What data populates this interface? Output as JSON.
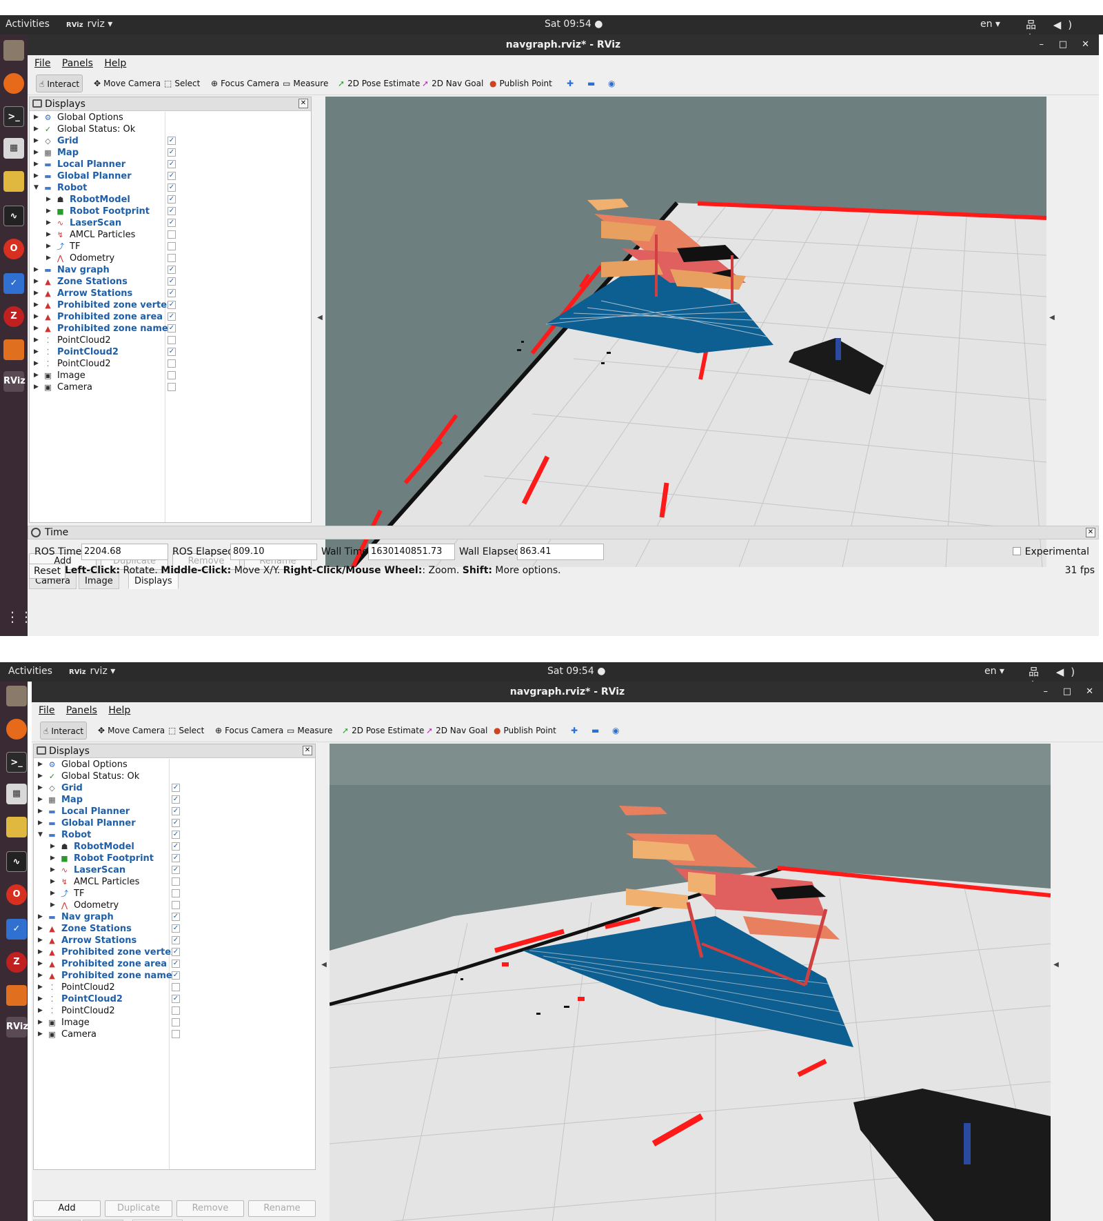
{
  "topbar": {
    "activities": "Activities",
    "app_icon": "RViz",
    "app": "rviz ▾",
    "clock": "Sat 09:54 ●",
    "lang": "en ▾",
    "tray": "品 ◀) ⏻ ▾"
  },
  "window": {
    "title": "navgraph.rviz* - RViz",
    "minimize": "–",
    "maximize": "□",
    "close": "✕"
  },
  "menu": [
    "File",
    "Panels",
    "Help"
  ],
  "toolbar": {
    "interact": "Interact",
    "move_camera": "Move Camera",
    "select": "Select",
    "focus_camera": "Focus Camera",
    "measure": "Measure",
    "pose_estimate": "2D Pose Estimate",
    "nav_goal": "2D Nav Goal",
    "publish_point": "Publish Point",
    "plus": "✚",
    "minus": "▬",
    "eye": "◉"
  },
  "displays": {
    "title": "Displays",
    "close": "✕",
    "items": [
      {
        "label": "Global Options",
        "checked": null,
        "bold": false,
        "indent": 0
      },
      {
        "label": "Global Status: Ok",
        "checked": null,
        "bold": false,
        "indent": 0
      },
      {
        "label": "Grid",
        "checked": true,
        "bold": true,
        "indent": 0
      },
      {
        "label": "Map",
        "checked": true,
        "bold": true,
        "indent": 0
      },
      {
        "label": "Local Planner",
        "checked": true,
        "bold": true,
        "indent": 0
      },
      {
        "label": "Global Planner",
        "checked": true,
        "bold": true,
        "indent": 0
      },
      {
        "label": "Robot",
        "checked": true,
        "bold": true,
        "indent": 0
      },
      {
        "label": "RobotModel",
        "checked": true,
        "bold": true,
        "indent": 1
      },
      {
        "label": "Robot Footprint",
        "checked": true,
        "bold": true,
        "indent": 1
      },
      {
        "label": "LaserScan",
        "checked": true,
        "bold": true,
        "indent": 1
      },
      {
        "label": "AMCL Particles",
        "checked": false,
        "bold": false,
        "indent": 1
      },
      {
        "label": "TF",
        "checked": false,
        "bold": false,
        "indent": 1
      },
      {
        "label": "Odometry",
        "checked": false,
        "bold": false,
        "indent": 1
      },
      {
        "label": "Nav graph",
        "checked": true,
        "bold": true,
        "indent": 0
      },
      {
        "label": "Zone Stations",
        "checked": true,
        "bold": true,
        "indent": 0
      },
      {
        "label": "Arrow Stations",
        "checked": true,
        "bold": true,
        "indent": 0
      },
      {
        "label": "Prohibited zone vertex",
        "checked": true,
        "bold": true,
        "indent": 0
      },
      {
        "label": "Prohibited zone area",
        "checked": true,
        "bold": true,
        "indent": 0
      },
      {
        "label": "Prohibited zone name",
        "checked": true,
        "bold": true,
        "indent": 0
      },
      {
        "label": "PointCloud2",
        "checked": false,
        "bold": false,
        "indent": 0
      },
      {
        "label": "PointCloud2",
        "checked": true,
        "bold": true,
        "indent": 0
      },
      {
        "label": "PointCloud2",
        "checked": false,
        "bold": false,
        "indent": 0
      },
      {
        "label": "Image",
        "checked": false,
        "bold": false,
        "indent": 0
      },
      {
        "label": "Camera",
        "checked": false,
        "bold": false,
        "indent": 0
      }
    ],
    "buttons": {
      "add": "Add",
      "duplicate": "Duplicate",
      "remove": "Remove",
      "rename": "Rename"
    }
  },
  "tabs": [
    "Camera",
    "Image",
    "Displays"
  ],
  "time_panel": {
    "title": "Time",
    "close": "✕",
    "ros_time_label": "ROS Time:",
    "ros_time": "2204.68",
    "ros_elapsed_label": "ROS Elapsed:",
    "ros_elapsed": "809.10",
    "wall_time_label": "Wall Time:",
    "wall_time": "1630140851.73",
    "wall_elapsed_label": "Wall Elapsed:",
    "wall_elapsed": "863.41",
    "experimental": "Experimental"
  },
  "status": {
    "reset": "Reset",
    "left_click": "Left-Click:",
    "rotate": " Rotate. ",
    "middle_click": "Middle-Click:",
    "move": " Move X/Y. ",
    "right_click": "Right-Click/Mouse Wheel:",
    "zoom": ": Zoom. ",
    "shift": "Shift:",
    "more": " More options.",
    "fps": "31 fps"
  },
  "colors": {
    "viewport_bg": "#6d7f7e",
    "floor": "#e4e4e4",
    "laser": "#ff1a1a",
    "costmap": "#0d5e91",
    "bold_item": "#1f5fa8",
    "dock": "#3a2a34"
  }
}
